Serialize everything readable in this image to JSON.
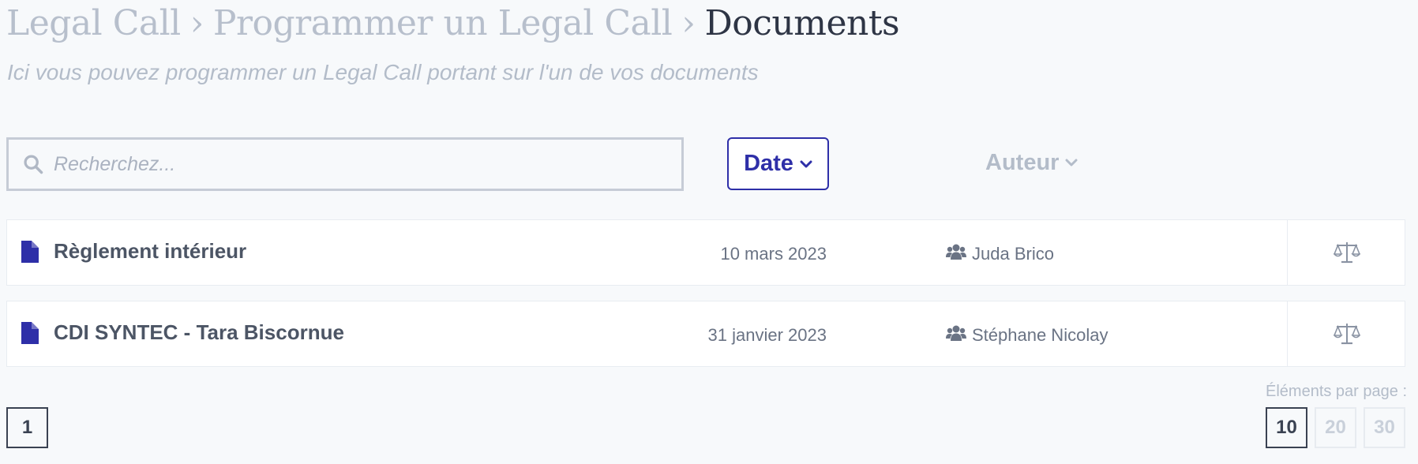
{
  "breadcrumb": {
    "items": [
      "Legal Call",
      "Programmer un Legal Call"
    ],
    "separator": "›",
    "current": "Documents"
  },
  "subtitle": "Ici vous pouvez programmer un Legal Call portant sur l'un de vos documents",
  "search": {
    "placeholder": "Recherchez...",
    "value": ""
  },
  "filters": {
    "date_label": "Date",
    "author_label": "Auteur"
  },
  "documents": [
    {
      "title": "Règlement intérieur",
      "date": "10 mars 2023",
      "author": "Juda Brico"
    },
    {
      "title": "CDI SYNTEC - Tara Biscornue",
      "date": "31 janvier 2023",
      "author": "Stéphane Nicolay"
    }
  ],
  "pagination": {
    "pages": [
      "1"
    ],
    "current_page": "1",
    "per_page_label": "Éléments par page :",
    "per_page_options": [
      "10",
      "20",
      "30"
    ],
    "per_page_selected": "10"
  },
  "colors": {
    "accent": "#2e2fa8",
    "text_dark": "#2e3545",
    "text_muted": "#b3bcc9",
    "background": "#f7f9fb"
  },
  "icons": {
    "search": "search-icon",
    "chevron": "chevron-down-icon",
    "file": "file-icon",
    "users": "users-icon",
    "action": "scale-icon"
  }
}
